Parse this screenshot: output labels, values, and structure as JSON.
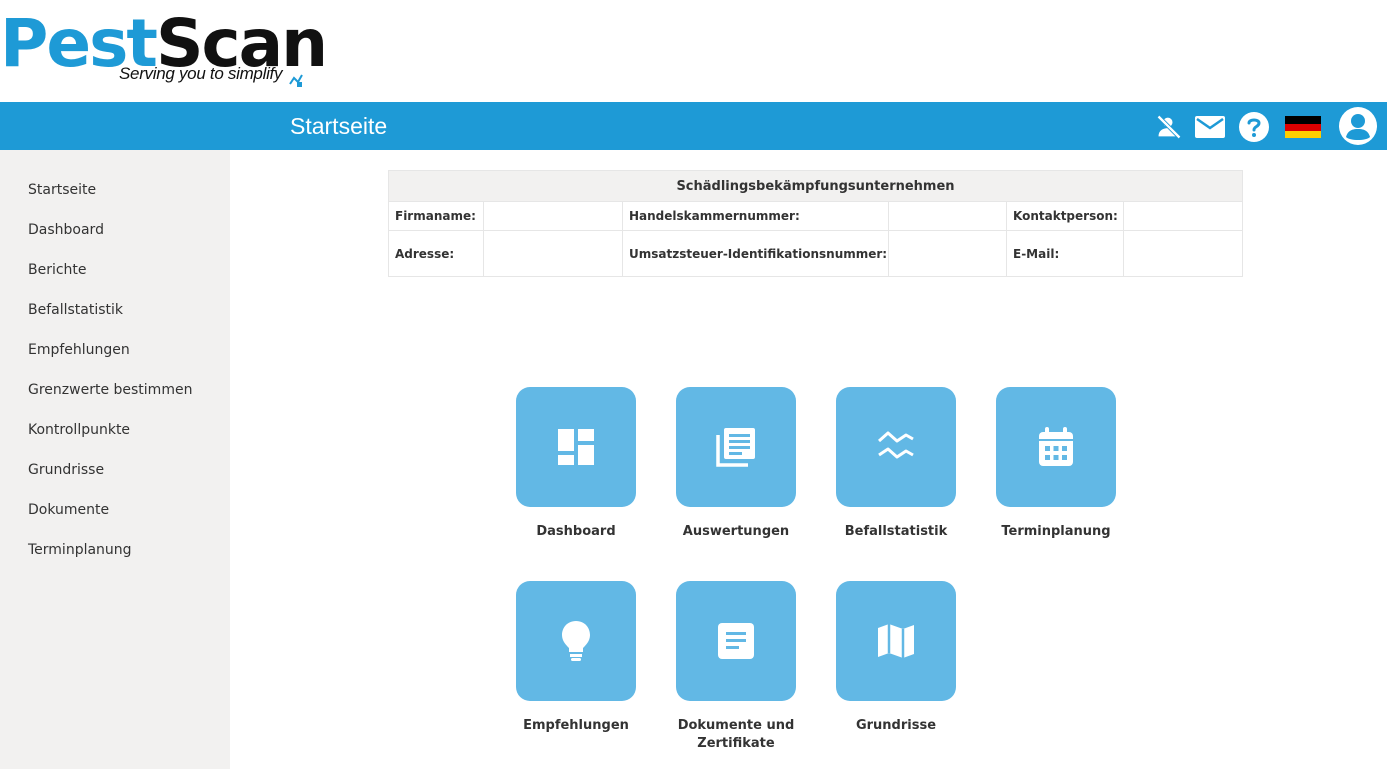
{
  "logo": {
    "part1": "Pest",
    "part2": "Scan",
    "tagline": "Serving you to simplify"
  },
  "header": {
    "title": "Startseite"
  },
  "sidebar": {
    "items": [
      {
        "label": "Startseite"
      },
      {
        "label": "Dashboard"
      },
      {
        "label": "Berichte"
      },
      {
        "label": "Befallstatistik"
      },
      {
        "label": "Empfehlungen"
      },
      {
        "label": "Grenzwerte bestimmen"
      },
      {
        "label": "Kontrollpunkte"
      },
      {
        "label": "Grundrisse"
      },
      {
        "label": "Dokumente"
      },
      {
        "label": "Terminplanung"
      }
    ]
  },
  "company": {
    "heading": "Schädlingsbekämpfungsunternehmen",
    "labels": {
      "name": "Firmaname:",
      "chamber": "Handelskammernummer:",
      "contact": "Kontaktperson:",
      "address": "Adresse:",
      "vat": "Umsatzsteuer-Identifikationsnummer:",
      "email": "E-Mail:"
    },
    "values": {
      "name": "",
      "chamber": "",
      "contact": "",
      "address": "",
      "vat": "",
      "email": ""
    }
  },
  "tiles": [
    {
      "label": "Dashboard",
      "icon": "dashboard-icon"
    },
    {
      "label": "Auswertungen",
      "icon": "reports-icon"
    },
    {
      "label": "Befallstatistik",
      "icon": "statistics-icon"
    },
    {
      "label": "Terminplanung",
      "icon": "calendar-icon"
    },
    {
      "label": "Empfehlungen",
      "icon": "lightbulb-icon"
    },
    {
      "label": "Dokumente und Zertifikate",
      "icon": "document-icon"
    },
    {
      "label": "Grundrisse",
      "icon": "map-icon"
    }
  ],
  "icons": {
    "header": [
      "notifications-off-icon",
      "mail-icon",
      "help-icon",
      "flag-de-icon",
      "user-avatar-icon"
    ]
  },
  "colors": {
    "brand": "#1e9ad6",
    "tile": "#62b8e5",
    "sidebar": "#f2f1f0"
  }
}
